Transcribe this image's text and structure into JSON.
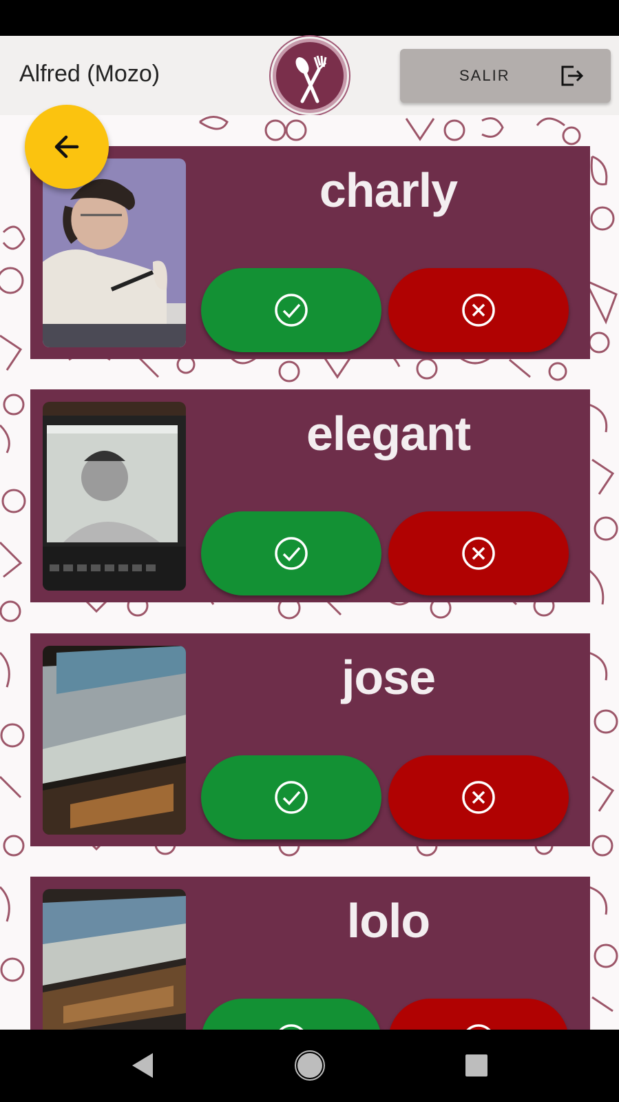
{
  "header": {
    "user_label": "Alfred (Mozo)",
    "exit_label": "SALIR"
  },
  "colors": {
    "accent": "#6e2e4a",
    "accept": "#139134",
    "reject": "#b00202",
    "fab": "#fbc30f"
  },
  "icons": {
    "back": "arrow-left-icon",
    "exit": "logout-icon",
    "accept": "check-circle-icon",
    "reject": "x-circle-icon",
    "logo": "spoon-fork-icon"
  },
  "clients": [
    {
      "name": "charly"
    },
    {
      "name": "elegant"
    },
    {
      "name": "jose"
    },
    {
      "name": "lolo"
    }
  ]
}
